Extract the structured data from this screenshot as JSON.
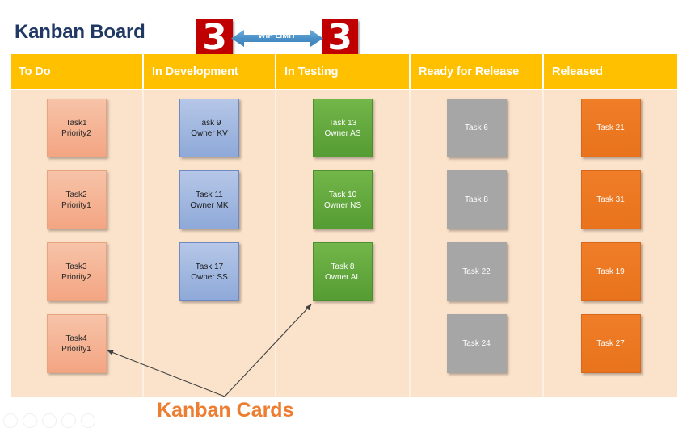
{
  "title": "Kanban Board",
  "wip": {
    "label": "WIP LIMIT",
    "left_value": "3",
    "right_value": "3",
    "arrow_color": "#4A90C8",
    "badge_color": "#C00000"
  },
  "caption": "Kanban Cards",
  "colors": {
    "title": "#1F3864",
    "header_band": "#FFC000",
    "board_background": "#FBE2CA",
    "caption": "#ED7D31",
    "todo_card": "#F3A582",
    "dev_card": "#8EA9D8",
    "test_card": "#5AA338",
    "ready_card": "#A6A6A6",
    "released_card": "#ED7D31"
  },
  "columns": [
    {
      "id": "to-do",
      "header": "To Do",
      "style": "todo",
      "cards": [
        {
          "title": "Task1",
          "sub": "Priority2"
        },
        {
          "title": "Task2",
          "sub": "Priority1"
        },
        {
          "title": "Task3",
          "sub": "Priority2"
        },
        {
          "title": "Task4",
          "sub": "Priority1"
        }
      ]
    },
    {
      "id": "in-development",
      "header": "In Development",
      "style": "dev",
      "cards": [
        {
          "title": "Task 9",
          "sub": "Owner KV"
        },
        {
          "title": "Task 11",
          "sub": "Owner MK"
        },
        {
          "title": "Task 17",
          "sub": "Owner SS"
        }
      ]
    },
    {
      "id": "in-testing",
      "header": "In Testing",
      "style": "test",
      "cards": [
        {
          "title": "Task 13",
          "sub": "Owner AS"
        },
        {
          "title": "Task 10",
          "sub": "Owner NS"
        },
        {
          "title": "Task 8",
          "sub": "Owner AL"
        }
      ]
    },
    {
      "id": "ready-for-release",
      "header": "Ready for Release",
      "style": "ready",
      "cards": [
        {
          "title": "Task 6",
          "sub": ""
        },
        {
          "title": "Task 8",
          "sub": ""
        },
        {
          "title": "Task 22",
          "sub": ""
        },
        {
          "title": "Task 24",
          "sub": ""
        }
      ]
    },
    {
      "id": "released",
      "header": "Released",
      "style": "released",
      "cards": [
        {
          "title": "Task 21",
          "sub": ""
        },
        {
          "title": "Task 31",
          "sub": ""
        },
        {
          "title": "Task 19",
          "sub": ""
        },
        {
          "title": "Task 27",
          "sub": ""
        }
      ]
    }
  ]
}
